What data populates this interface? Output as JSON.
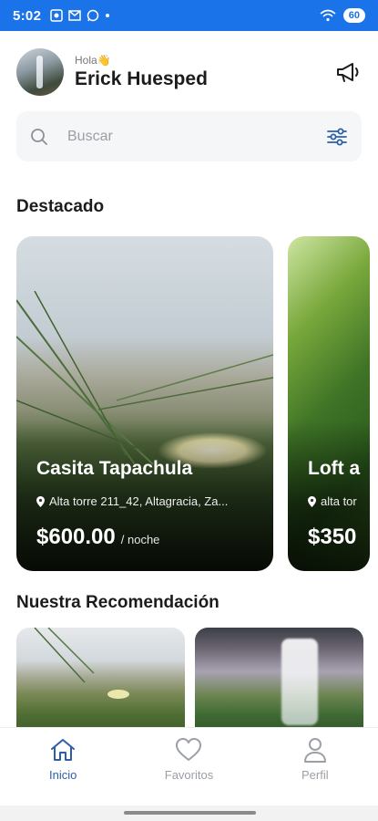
{
  "status_bar": {
    "time": "5:02",
    "battery": "60"
  },
  "header": {
    "greeting": "Hola👋",
    "user_name": "Erick Huesped"
  },
  "search": {
    "placeholder": "Buscar"
  },
  "sections": {
    "featured_title": "Destacado",
    "recommended_title": "Nuestra Recomendación"
  },
  "featured": [
    {
      "title": "Casita Tapachula",
      "location": "Alta torre 211_42, Altagracia, Za...",
      "price": "$600.00",
      "unit": "/ noche"
    },
    {
      "title": "Loft a",
      "location": "alta tor",
      "price": "$350",
      "unit": ""
    }
  ],
  "bottom_nav": [
    {
      "label": "Inicio",
      "icon": "home-icon",
      "active": true
    },
    {
      "label": "Favoritos",
      "icon": "heart-icon",
      "active": false
    },
    {
      "label": "Perfil",
      "icon": "profile-icon",
      "active": false
    }
  ],
  "colors": {
    "status_bar": "#1a73e8",
    "accent": "#2c5fa8",
    "inactive": "#9aa0a6"
  }
}
